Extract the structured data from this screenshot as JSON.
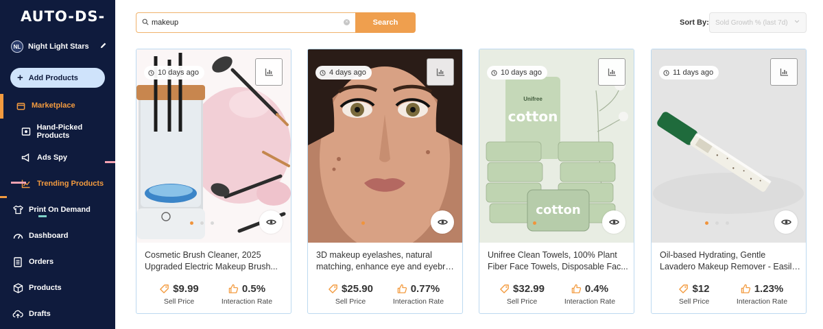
{
  "sidebar": {
    "logo": "AUTO-DS-",
    "user": {
      "initials": "NL",
      "name": "Night Light Stars"
    },
    "add_button": "Add Products",
    "items": [
      {
        "label": "Marketplace"
      },
      {
        "label": "Hand-Picked Products"
      },
      {
        "label": "Ads Spy"
      },
      {
        "label": "Trending Products"
      },
      {
        "label": "Print On Demand"
      },
      {
        "label": "Dashboard"
      },
      {
        "label": "Orders"
      },
      {
        "label": "Products"
      },
      {
        "label": "Drafts"
      }
    ]
  },
  "search": {
    "value": "makeup",
    "button": "Search"
  },
  "sort": {
    "label": "Sort By:",
    "value": "Sold Growth % (last 7d)"
  },
  "colors": {
    "sidebar_bg": "#0f1b3d",
    "accent_orange": "#f39b3f",
    "card_border": "#bcd9f0"
  },
  "products": [
    {
      "age": "10 days ago",
      "title_line1": "Cosmetic Brush Cleaner, 2025",
      "title_line2": "Upgraded Electric Makeup Brush...",
      "price": "$9.99",
      "price_label": "Sell Price",
      "rate": "0.5%",
      "rate_label": "Interaction Rate"
    },
    {
      "age": "4 days ago",
      "title_line1": "3D makeup eyelashes, natural",
      "title_line2": "matching, enhance eye and eyebro...",
      "price": "$25.90",
      "price_label": "Sell Price",
      "rate": "0.77%",
      "rate_label": "Interaction Rate"
    },
    {
      "age": "10 days ago",
      "title_line1": "Unifree Clean Towels, 100% Plant",
      "title_line2": "Fiber Face Towels, Disposable Fac...",
      "price": "$32.99",
      "price_label": "Sell Price",
      "rate": "0.4%",
      "rate_label": "Interaction Rate",
      "brand": "Unifree",
      "package_text": "cotton"
    },
    {
      "age": "11 days ago",
      "title_line1": "Oil-based Hydrating, Gentle",
      "title_line2": "Lavadero Makeup Remover - Easily...",
      "price": "$12",
      "price_label": "Sell Price",
      "rate": "1.23%",
      "rate_label": "Interaction Rate"
    }
  ]
}
